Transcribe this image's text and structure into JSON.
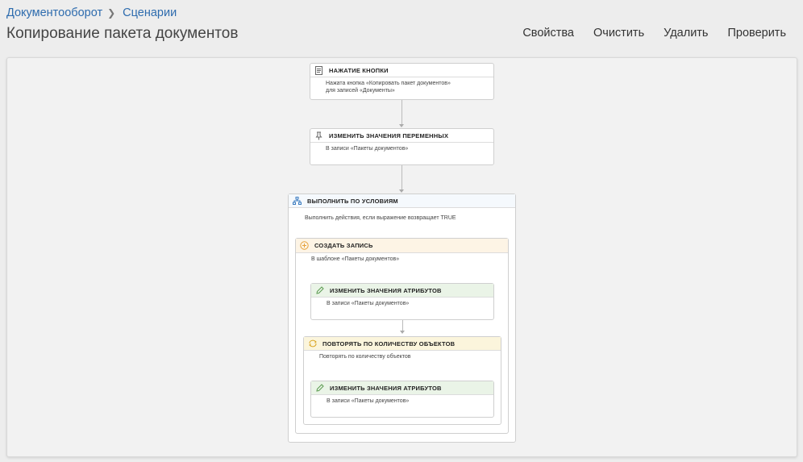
{
  "breadcrumb": {
    "root": "Документооборот",
    "current": "Сценарии"
  },
  "page": {
    "title": "Копирование пакета документов"
  },
  "toolbar": {
    "properties": "Свойства",
    "clear": "Очистить",
    "delete": "Удалить",
    "check": "Проверить"
  },
  "flow": {
    "trigger": {
      "title": "НАЖАТИЕ КНОПКИ",
      "desc_line1": "Нажата кнопка «Копировать пакет документов»",
      "desc_line2": "для записей «Документы»",
      "icon": "document-icon"
    },
    "set_vars": {
      "title": "ИЗМЕНИТЬ ЗНАЧЕНИЯ ПЕРЕМЕННЫХ",
      "desc": "В записи «Пакеты документов»",
      "icon": "pin-icon"
    },
    "condition": {
      "title": "ВЫПОЛНИТЬ ПО УСЛОВИЯМ",
      "desc": "Выполнить действия, если выражение возвращает TRUE",
      "icon": "hierarchy-icon"
    },
    "create": {
      "title": "СОЗДАТЬ ЗАПИСЬ",
      "desc": "В шаблоне «Пакеты документов»",
      "icon": "plus-circle-icon"
    },
    "attrs1": {
      "title": "ИЗМЕНИТЬ ЗНАЧЕНИЯ АТРИБУТОВ",
      "desc": "В записи «Пакеты документов»",
      "icon": "pencil-icon"
    },
    "repeat": {
      "title": "ПОВТОРЯТЬ ПО КОЛИЧЕСТВУ ОБЪЕКТОВ",
      "desc": "Повторять по количеству объектов",
      "icon": "repeat-icon"
    },
    "attrs2": {
      "title": "ИЗМЕНИТЬ ЗНАЧЕНИЯ АТРИБУТОВ",
      "desc": "В записи «Пакеты документов»",
      "icon": "pencil-icon"
    }
  }
}
